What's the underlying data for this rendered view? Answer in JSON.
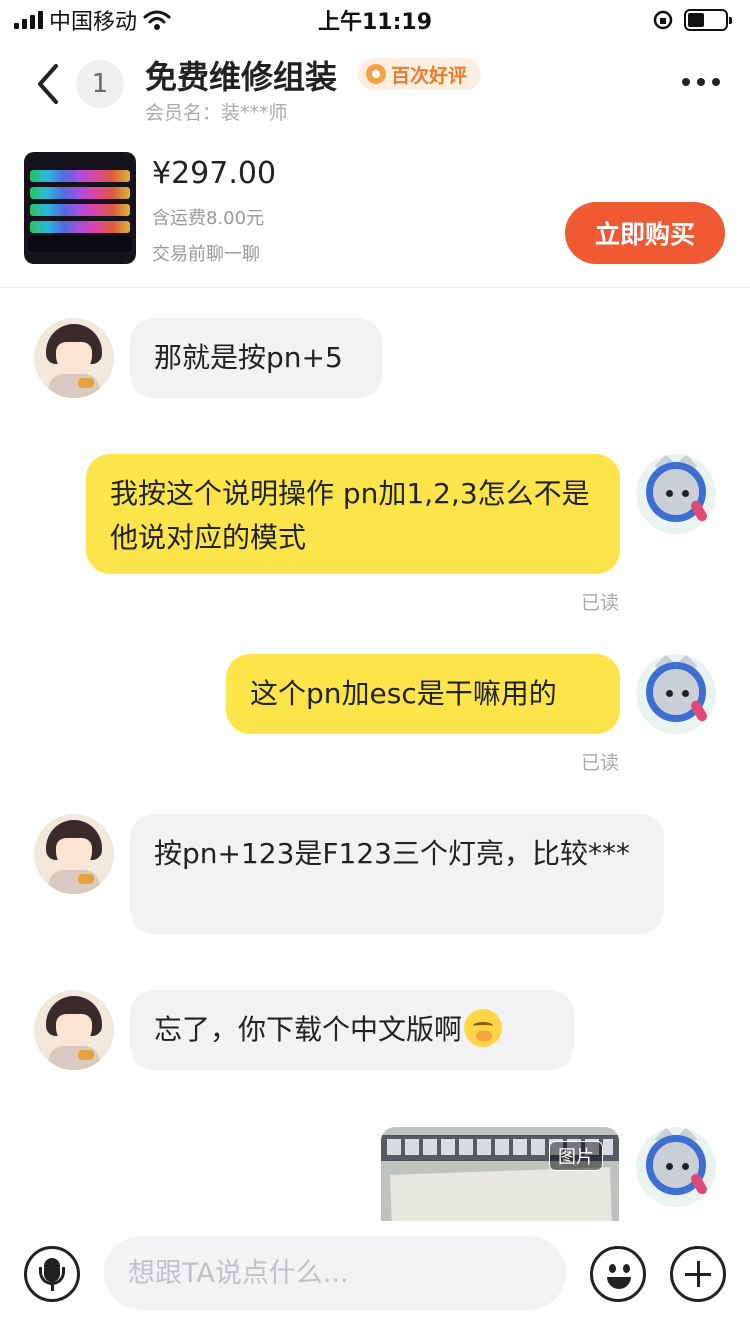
{
  "status_bar": {
    "carrier": "中国移动",
    "time": "上午11:19"
  },
  "header": {
    "unread_count": "1",
    "shop_title": "免费维修组装",
    "badge": "百次好评",
    "member": "会员名：装***师"
  },
  "product": {
    "price": "¥297.00",
    "shipping": "含运费8.00元",
    "note": "交易前聊一聊",
    "buy_label": "立即购买"
  },
  "messages": [
    {
      "side": "left",
      "text": "那就是按pn+5"
    },
    {
      "side": "right",
      "text": "我按这个说明操作 pn加1,2,3怎么不是他说对应的模式",
      "status": "已读"
    },
    {
      "side": "right",
      "text": "这个pn加esc是干嘛用的",
      "status": "已读"
    },
    {
      "side": "left",
      "text": "按pn+123是F123三个灯亮，比较***"
    },
    {
      "side": "left",
      "text": "忘了，你下载个中文版啊",
      "emoji": "yawn-emoji"
    },
    {
      "side": "right",
      "type": "image",
      "label": "图片"
    }
  ],
  "input_bar": {
    "placeholder": "想跟TA说点什么..."
  },
  "icons": {
    "back": "chevron-left-icon",
    "more": "more-dots-icon",
    "mic": "microphone-icon",
    "emoji": "smiley-icon",
    "plus": "plus-icon"
  },
  "colors": {
    "buy_button": "#f05a33",
    "my_bubble": "#fbe54a",
    "their_bubble": "#f2f2f4",
    "badge_text": "#f07a2a"
  }
}
